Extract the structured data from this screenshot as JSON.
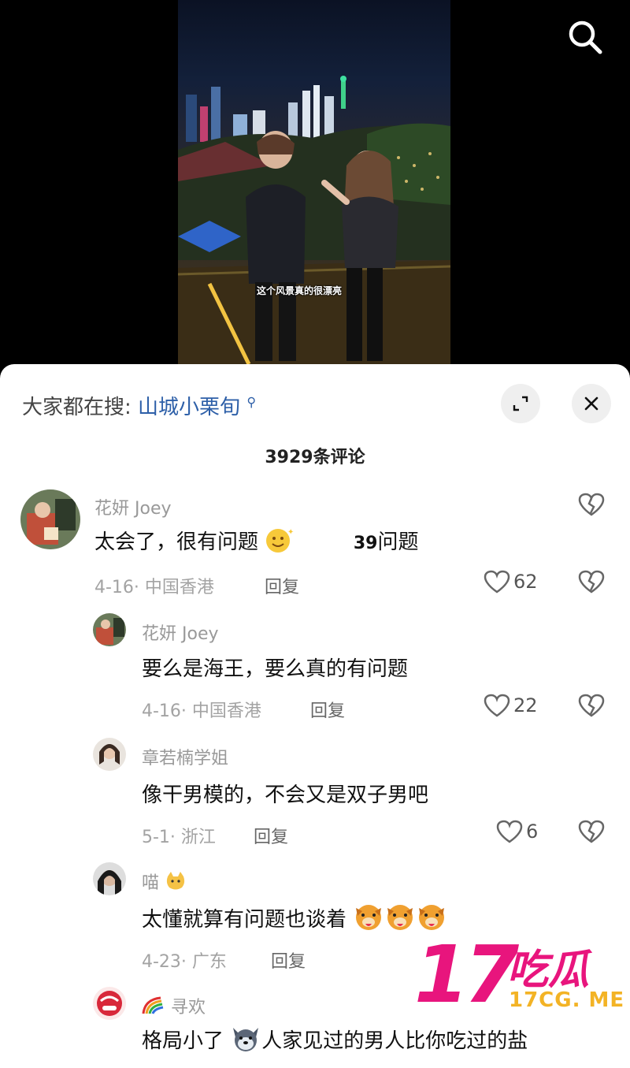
{
  "video": {
    "subtitle": "这个风景真的很漂亮"
  },
  "icons": {
    "search": "search-icon",
    "expand": "expand-icon",
    "close": "close-icon",
    "like": "heart-icon",
    "dislike": "broken-heart-icon"
  },
  "sheet": {
    "trending_prefix": "大家都在搜:",
    "trending_keyword": "山城小栗旬",
    "comment_count_title": "3929条评论"
  },
  "comments": [
    {
      "user": "花妍 Joey",
      "text": "太会了，很有问题",
      "emoji_text": "39",
      "suffix": "问题",
      "date_location": "4-16· 中国香港",
      "reply": "回复",
      "likes": "62"
    },
    {
      "user": "花妍 Joey",
      "text": "要么是海王，要么真的有问题",
      "date_location": "4-16· 中国香港",
      "reply": "回复",
      "likes": "22"
    },
    {
      "user": "章若楠学姐",
      "text": "像干男模的，不会又是双子男吧",
      "date_location": "5-1· 浙江",
      "reply": "回复",
      "likes": "6"
    },
    {
      "user": "喵",
      "text": "太懂就算有问题也谈着",
      "date_location": "4-23· 广东",
      "reply": "回复"
    },
    {
      "user": "寻欢",
      "text_pre": "格局小了",
      "text_post": "人家见过的男人比你吃过的盐"
    }
  ],
  "watermark": {
    "number": "17",
    "chinese": "吃瓜",
    "url": "17CG. ME"
  },
  "colors": {
    "brand_pink": "#e8157d",
    "brand_yellow": "#f3b325",
    "link_blue": "#2d5fa8"
  }
}
